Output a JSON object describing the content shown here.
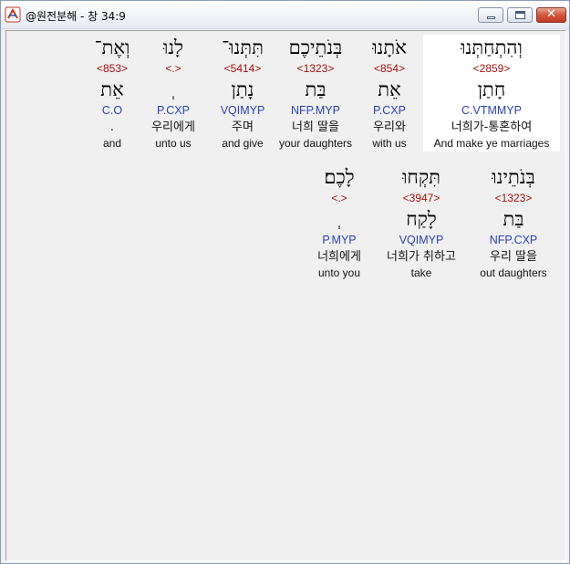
{
  "window": {
    "title": "@원전분해 - 창 34:9",
    "close_glyph": "✕"
  },
  "rows": [
    [
      {
        "hebrew": "וְהִתְחַתְּנוּ",
        "strong": "<2859>",
        "lemma": "חָתַן",
        "parse": "C.VTMMYP",
        "korean": "너희가-통혼하여",
        "english": "And make ye marriages",
        "selected": true
      },
      {
        "hebrew": "אֹתָנוּ",
        "strong": "<854>",
        "lemma": "אֵת",
        "parse": "P.CXP",
        "korean": "우리와",
        "english": "with us",
        "selected": false
      },
      {
        "hebrew": "בְּנֹתֵיכֶם",
        "strong": "<1323>",
        "lemma": "בַּת",
        "parse": "NFP.MYP",
        "korean": "너희 딸을",
        "english": "your daughters",
        "selected": false
      },
      {
        "hebrew": "תִּתְּנוּ־",
        "strong": "<5414>",
        "lemma": "נָתַן",
        "parse": "VQIMYP",
        "korean": "주며",
        "english": "and give",
        "selected": false
      },
      {
        "hebrew": "לָנוּ",
        "strong": "<.>",
        "lemma": "ְ",
        "parse": "P.CXP",
        "korean": "우리에게",
        "english": "unto us",
        "selected": false
      },
      {
        "hebrew": "וְאֶת־",
        "strong": "<853>",
        "lemma": "אֵת",
        "parse": "C.O",
        "korean": ".",
        "english": "and",
        "selected": false
      }
    ],
    [
      {
        "hebrew": "בְּנֹתֵינוּ",
        "strong": "<1323>",
        "lemma": "בַּת",
        "parse": "NFP.CXP",
        "korean": "우리 딸을",
        "english": "out daughters",
        "selected": false
      },
      {
        "hebrew": "תִּקְחוּ",
        "strong": "<3947>",
        "lemma": "לָקַח",
        "parse": "VQIMYP",
        "korean": "너희가 취하고",
        "english": "take",
        "selected": false
      },
      {
        "hebrew": "לָכֶם׃",
        "strong": "<.>",
        "lemma": "ְ",
        "parse": "P.MYP",
        "korean": "너희에게",
        "english": "unto you",
        "selected": false
      }
    ]
  ]
}
